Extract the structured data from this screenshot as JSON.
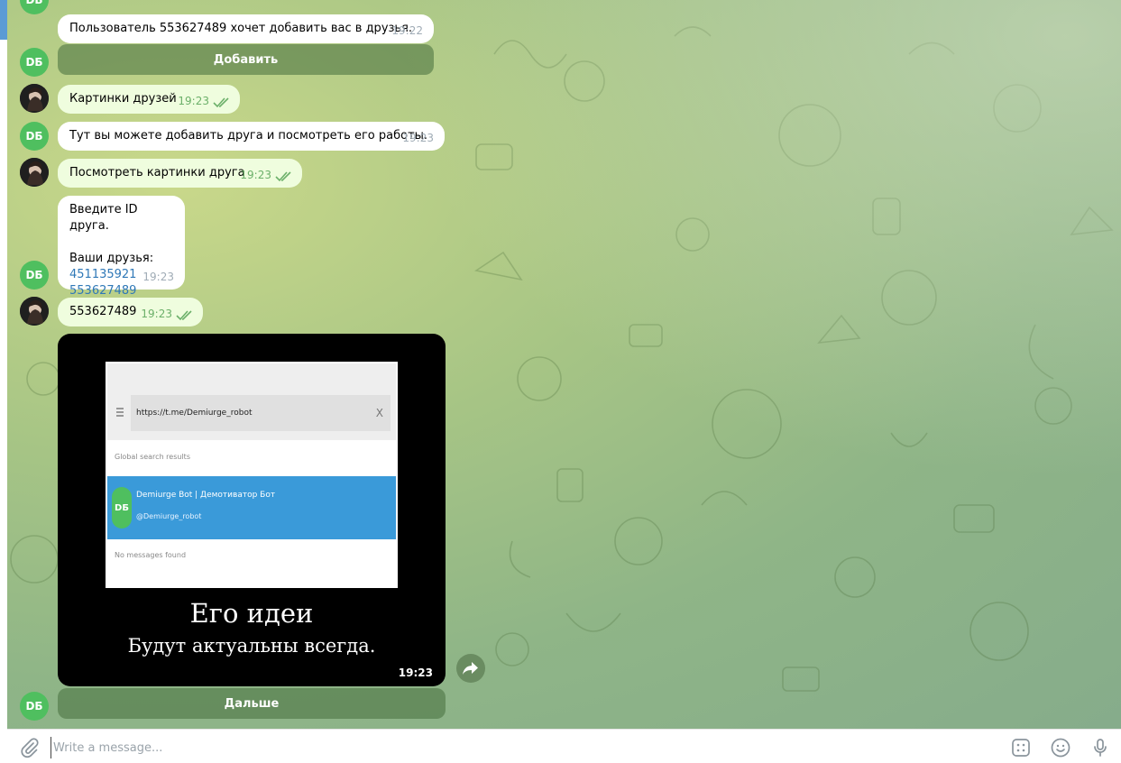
{
  "composer": {
    "placeholder": "Write a message..."
  },
  "avatars": {
    "bot_initials": "DБ"
  },
  "messages": [
    {
      "text": "Пользователь 553627489 хочет добавить вас в друзья.",
      "time": "19:22"
    },
    {
      "button": "Добавить"
    },
    {
      "text": "Картинки друзей",
      "time": "19:23"
    },
    {
      "text": "Тут вы можете добавить друга и посмотреть его работы.",
      "time": "19:23"
    },
    {
      "text": "Посмотреть картинки друга",
      "time": "19:23"
    },
    {
      "line1": "Введите ID друга.",
      "line2": "Ваши друзья:",
      "links": [
        "451135921",
        "553627489"
      ],
      "time": "19:23"
    },
    {
      "text": "553627489",
      "time": "19:23"
    },
    {
      "photo": {
        "url": "https://t.me/Demiurge_robot",
        "global": "Global search results",
        "name": "Demiurge Bot | Демотиватор Бот",
        "handle": "@Demiurge_robot",
        "none": "No messages found",
        "caption_title": "Его идеи",
        "caption_sub": "Будут актуальны всегда.",
        "time": "19:23"
      }
    },
    {
      "button": "Дальше"
    }
  ],
  "icons": {
    "attach": "paperclip-icon",
    "commands": "bot-commands-icon",
    "emoji": "emoji-icon",
    "mic": "microphone-icon",
    "share": "share-icon",
    "read": "double-check-icon"
  },
  "colors": {
    "accent": "#5b9bd5",
    "bot_avatar": "#4fbf5f",
    "out_bubble": "#effdde",
    "read_check": "#6cb06a",
    "link": "#2f78b7"
  }
}
